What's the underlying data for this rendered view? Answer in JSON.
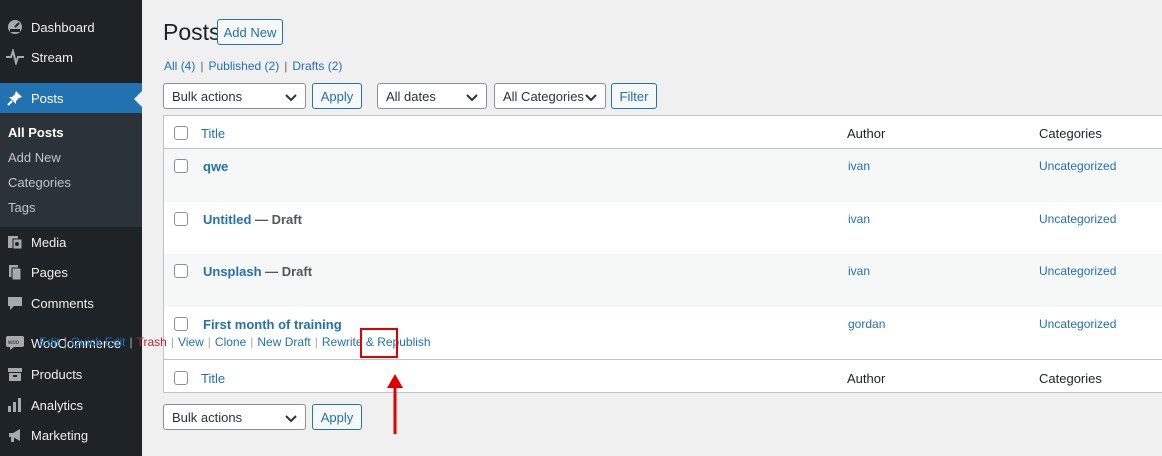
{
  "sidebar": {
    "items": [
      {
        "label": "Dashboard",
        "icon": "dashboard-icon"
      },
      {
        "label": "Stream",
        "icon": "stream-icon"
      },
      {
        "label": "Posts",
        "icon": "pin-icon"
      },
      {
        "label": "Media",
        "icon": "media-icon"
      },
      {
        "label": "Pages",
        "icon": "pages-icon"
      },
      {
        "label": "Comments",
        "icon": "comments-icon"
      },
      {
        "label": "WooCommerce",
        "icon": "woocommerce-icon"
      },
      {
        "label": "Products",
        "icon": "products-icon"
      },
      {
        "label": "Analytics",
        "icon": "analytics-icon"
      },
      {
        "label": "Marketing",
        "icon": "marketing-icon"
      }
    ],
    "submenu": [
      "All Posts",
      "Add New",
      "Categories",
      "Tags"
    ]
  },
  "header": {
    "title": "Posts",
    "add_new": "Add New"
  },
  "filters": {
    "all": "All",
    "all_count": "(4)",
    "published": "Published",
    "published_count": "(2)",
    "drafts": "Drafts",
    "drafts_count": "(2)",
    "sep": "|"
  },
  "toolbar": {
    "bulk_actions": "Bulk actions",
    "apply": "Apply",
    "all_dates": "All dates",
    "all_categories": "All Categories",
    "filter": "Filter"
  },
  "table": {
    "columns": [
      "Title",
      "Author",
      "Categories"
    ],
    "rows": [
      {
        "title": "qwe",
        "state": "",
        "author": "ivan",
        "category": "Uncategorized"
      },
      {
        "title": "Untitled",
        "state": " — Draft",
        "author": "ivan",
        "category": "Uncategorized"
      },
      {
        "title": "Unsplash",
        "state": " — Draft",
        "author": "ivan",
        "category": "Uncategorized"
      },
      {
        "title": "First month of training",
        "state": "",
        "author": "gordan",
        "category": "Uncategorized"
      }
    ],
    "row_actions": [
      "Edit",
      "Quick Edit",
      "Trash",
      "View",
      "Clone",
      "New Draft",
      "Rewrite & Republish"
    ]
  },
  "colors": {
    "sidebar_bg": "#1d2327",
    "accent": "#2271b1",
    "highlight": "#e10000",
    "trash": "#b32d2e"
  }
}
